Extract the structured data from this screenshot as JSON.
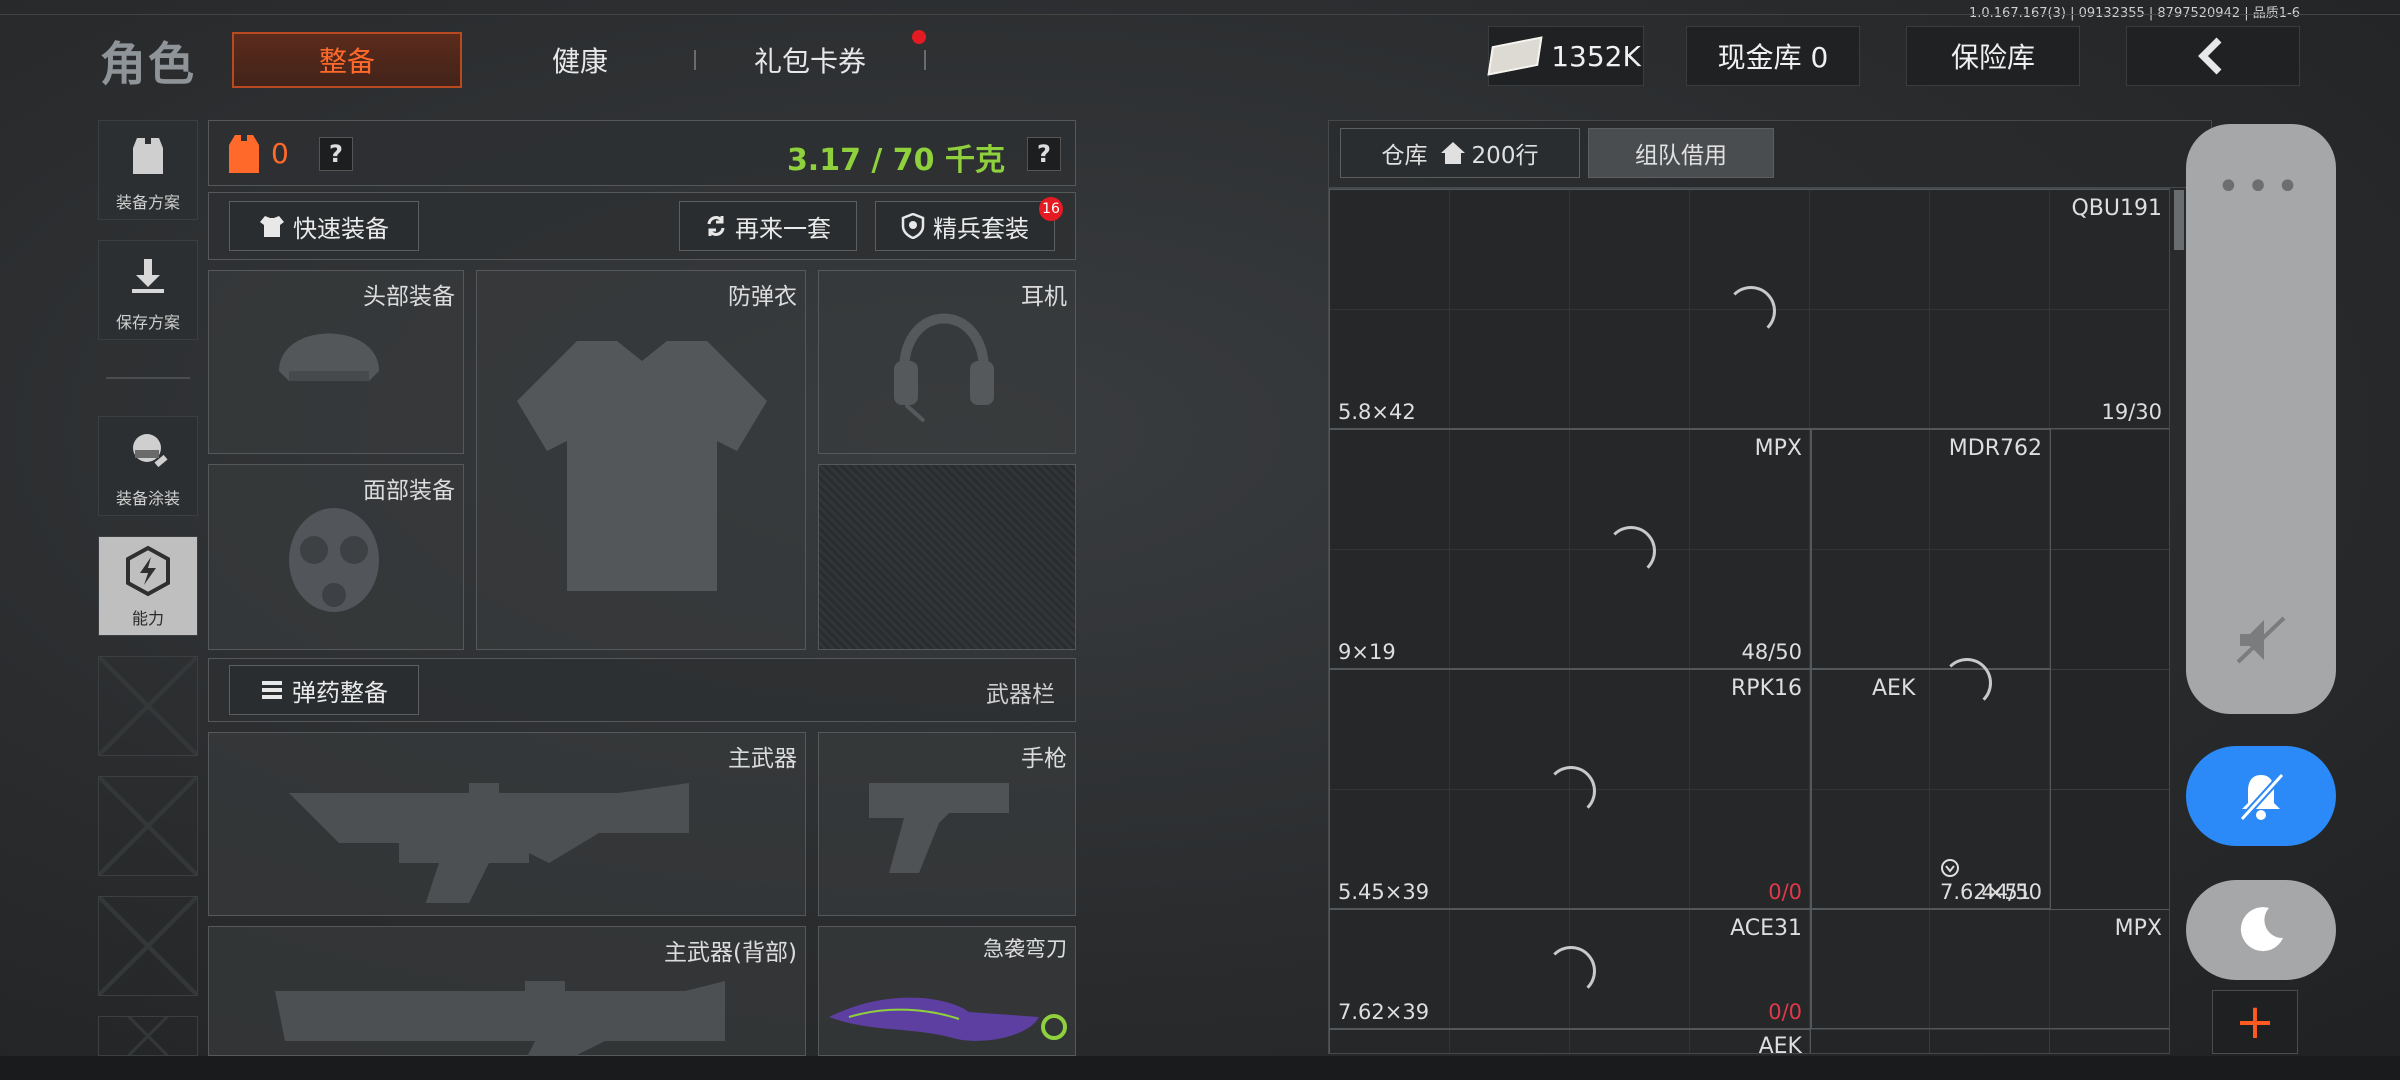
{
  "version": "1.0.167.167(3) | 09132355 | 8797520942 | 品质1-6",
  "nav": {
    "title": "角色",
    "tabs": [
      {
        "label": "整备",
        "active": true
      },
      {
        "label": "健康",
        "active": false
      },
      {
        "label": "礼包卡券",
        "active": false,
        "badge": true
      }
    ]
  },
  "header": {
    "money": "1352K",
    "cash_vault": "现金库 0",
    "insurance": "保险库",
    "back_icon": "chevron-left-icon"
  },
  "sidebar": {
    "items": [
      {
        "label": "装备方案",
        "icon": "vest-icon"
      },
      {
        "label": "保存方案",
        "icon": "download-icon"
      },
      {
        "label": "装备涂装",
        "icon": "helmet-paint-icon"
      },
      {
        "label": "能力",
        "icon": "ability-icon",
        "active": true
      }
    ]
  },
  "loadout": {
    "armor_count": "0",
    "weight": "3.17 / 70 千克",
    "quick_equip": "快速装备",
    "again_set": "再来一套",
    "elite_set": "精兵套装",
    "elite_badge": "16",
    "slots": {
      "head": "头部装备",
      "vest": "防弹衣",
      "headset": "耳机",
      "face": "面部装备"
    },
    "ammo_btn": "弹药整备",
    "weapon_bar": "武器栏",
    "primary": "主武器",
    "pistol": "手枪",
    "primary_back": "主武器(背部)",
    "melee": "急袭弯刀"
  },
  "warehouse": {
    "tab_label": "仓库",
    "rows": "200行",
    "team_borrow": "组队借用",
    "items": [
      {
        "name": "QBU191",
        "caliber": "5.8×42",
        "count": "19/30"
      },
      {
        "name": "MPX",
        "caliber": "9×19",
        "count": "48/50"
      },
      {
        "name": "MDR762",
        "caliber": "",
        "count": ""
      },
      {
        "name": "RPK16",
        "caliber": "5.45×39",
        "count": "0/0"
      },
      {
        "name": "AEK",
        "caliber": "7.62×51",
        "count": "44/50"
      },
      {
        "name": "ACE31",
        "caliber": "7.62×39",
        "count": "0/0"
      },
      {
        "name": "MPX",
        "caliber": "",
        "count": ""
      },
      {
        "name": "AEK",
        "caliber": "",
        "count": ""
      }
    ]
  },
  "colors": {
    "accent": "#ff6a2b",
    "weight_green": "#8fd13c",
    "blue_button": "#2b8af7"
  }
}
